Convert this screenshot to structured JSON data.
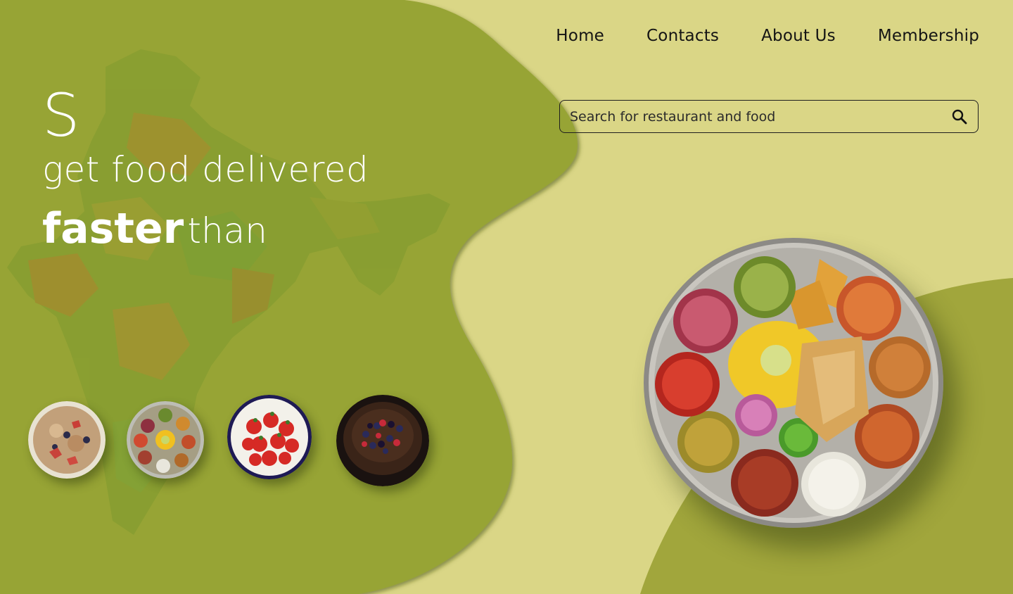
{
  "nav": {
    "items": [
      {
        "label": "Home"
      },
      {
        "label": "Contacts"
      },
      {
        "label": "About Us"
      },
      {
        "label": "Membership"
      }
    ]
  },
  "search": {
    "placeholder": "Search for restaurant and food",
    "value": "",
    "icon": "search-icon"
  },
  "hero": {
    "letter": "S",
    "line1": "get food delivered",
    "line2_bold": "faster",
    "line2_light": "than"
  },
  "thumbnails": [
    {
      "name": "oatmeal-bowl"
    },
    {
      "name": "thali-plate"
    },
    {
      "name": "strawberry-bowl"
    },
    {
      "name": "chocolate-berry-cake"
    }
  ],
  "featured": {
    "name": "thali-platter"
  },
  "colors": {
    "background": "#dad686",
    "green_shape": "#97a434",
    "text": "#ffffff",
    "nav_text": "#141414"
  }
}
